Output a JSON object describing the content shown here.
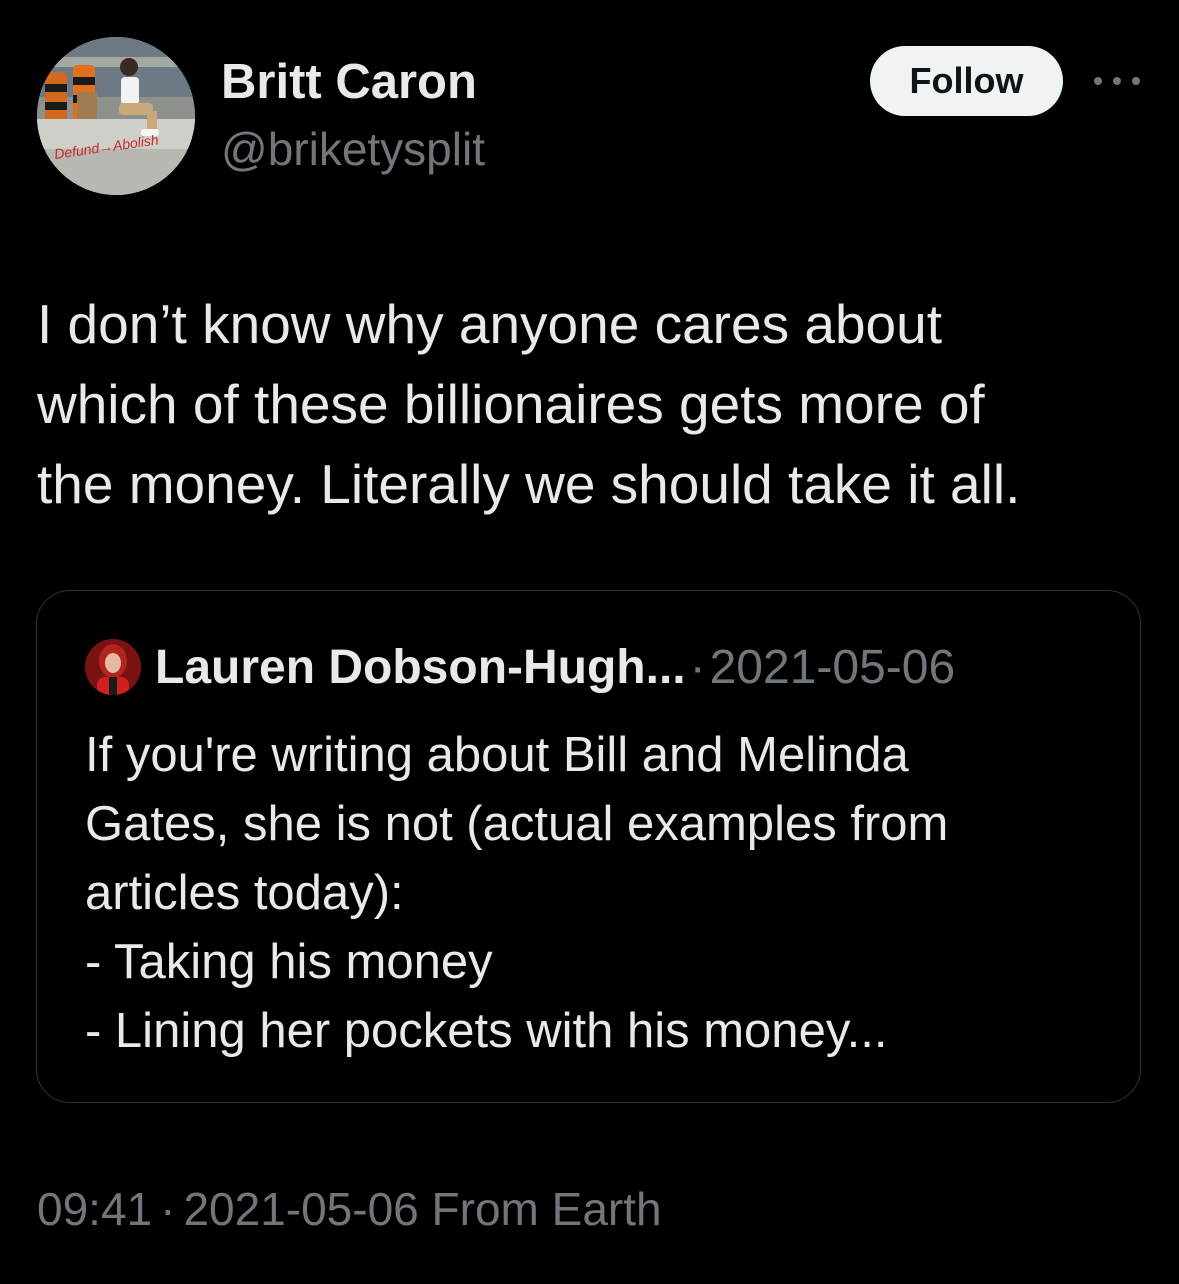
{
  "author": {
    "name": "Britt Caron",
    "handle": "@briketysplit",
    "avatar_sign_text": "Defund → Abolish"
  },
  "actions": {
    "follow_label": "Follow",
    "more_icon": "more-horizontal-icon"
  },
  "tweet": {
    "lines": [
      "I don’t know why anyone cares about",
      "which of these billionaires gets more of",
      "the money. Literally we should take it all."
    ]
  },
  "quote": {
    "author_name": "Lauren Dobson-Hugh...",
    "separator": "·",
    "date": "2021-05-06",
    "lines": [
      "If you're writing about Bill and Melinda",
      "Gates, she is not (actual examples from",
      "articles today):",
      "- Taking his money",
      "- Lining her pockets with his money..."
    ]
  },
  "footer": {
    "time": "09:41",
    "separator": "·",
    "date_source": "2021-05-06 From Earth"
  },
  "colors": {
    "background": "#000000",
    "text_primary": "#e7e9ea",
    "text_secondary": "#71767b",
    "border": "#2f3336",
    "follow_bg": "#eff3f4"
  }
}
